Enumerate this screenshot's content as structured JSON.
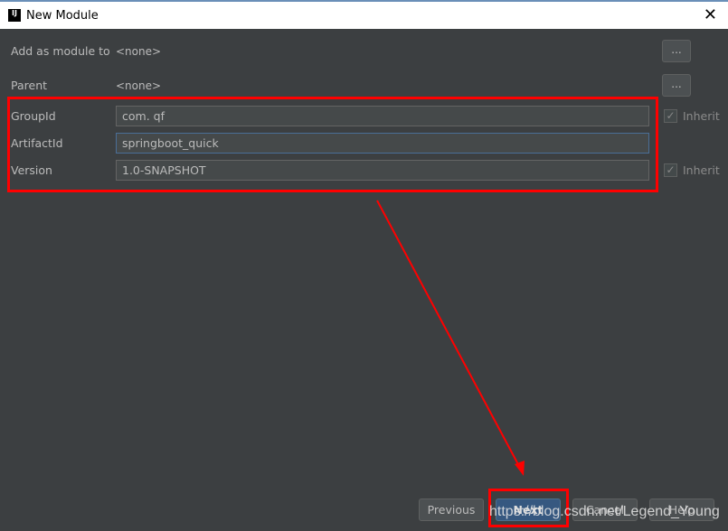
{
  "window": {
    "title": "New Module",
    "logo": "IJ",
    "close_icon": "close-icon"
  },
  "form": {
    "add_as_module_label": "Add as module to",
    "add_as_module_value": "<none>",
    "parent_label": "Parent",
    "parent_value": "<none>",
    "browse_label": "...",
    "group_id_label": "GroupId",
    "group_id_value": "com. qf",
    "artifact_id_label": "ArtifactId",
    "artifact_id_value": "springboot_quick",
    "version_label": "Version",
    "version_value": "1.0-SNAPSHOT",
    "inherit_label": "Inherit",
    "group_inherit_checked": true,
    "version_inherit_checked": true
  },
  "buttons": {
    "previous": "Previous",
    "next": "Next",
    "cancel": "Cancel",
    "help": "Help"
  },
  "annotation_color": "#ff0000",
  "watermark": "https://blog.csdn.net/Legend_Young"
}
